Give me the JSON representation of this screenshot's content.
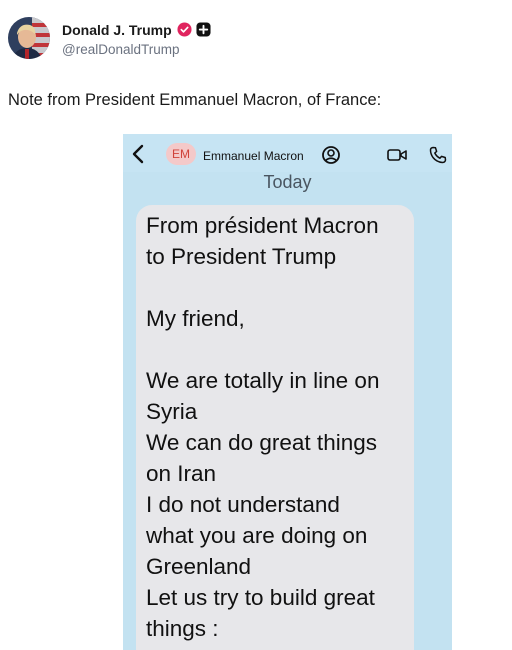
{
  "post": {
    "author_name": "Donald J. Trump",
    "author_handle": "@realDonaldTrump",
    "text": "Note from President Emmanuel Macron, of France:"
  },
  "screenshot": {
    "contact_initials": "EM",
    "contact_name": "Emmanuel Macron",
    "day_label": "Today",
    "message_lines": [
      "From président Macron",
      "to President Trump",
      "",
      "My friend,",
      "",
      "We are totally in line on",
      "Syria",
      "We can do great things",
      "on Iran",
      "I do not understand",
      "what you are doing on",
      "Greenland",
      "Let us try to build great",
      "things :"
    ]
  },
  "icons": {
    "verified": "verified-badge-icon",
    "plus": "plus-badge-icon",
    "back": "chevron-left-icon",
    "contact": "contact-person-icon",
    "video": "video-camera-icon",
    "phone": "phone-icon"
  },
  "colors": {
    "verified_badge": "#e0245e",
    "screenshot_background": "#c3e2f1",
    "bubble": "#e7e7ea",
    "initials_badge": "#f4c9c9"
  }
}
